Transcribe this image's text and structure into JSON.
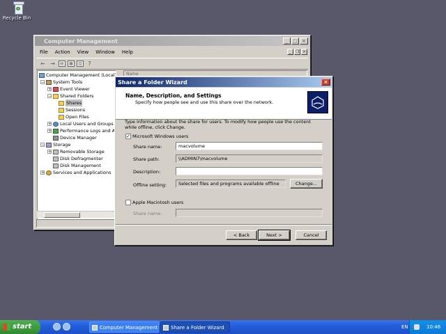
{
  "desktop": {
    "recycle_bin_label": "Recycle Bin"
  },
  "computer_management": {
    "title": "Computer Management",
    "menu": [
      "File",
      "Action",
      "View",
      "Window",
      "Help"
    ],
    "column_header": "Name",
    "tree": [
      {
        "label": "Computer Management (Local)",
        "icon": "computer-icon"
      },
      {
        "label": "System Tools",
        "icon": "tools-icon"
      },
      {
        "label": "Event Viewer",
        "icon": "event-viewer-icon"
      },
      {
        "label": "Shared Folders",
        "icon": "folder-icon"
      },
      {
        "label": "Shares",
        "icon": "folder-icon"
      },
      {
        "label": "Sessions",
        "icon": "folder-icon"
      },
      {
        "label": "Open Files",
        "icon": "folder-icon"
      },
      {
        "label": "Local Users and Groups",
        "icon": "users-icon"
      },
      {
        "label": "Performance Logs and Al",
        "icon": "performance-icon"
      },
      {
        "label": "Device Manager",
        "icon": "device-manager-icon"
      },
      {
        "label": "Storage",
        "icon": "storage-icon"
      },
      {
        "label": "Removable Storage",
        "icon": "disk-icon"
      },
      {
        "label": "Disk Defragmenter",
        "icon": "disk-icon"
      },
      {
        "label": "Disk Management",
        "icon": "disk-icon"
      },
      {
        "label": "Services and Applications",
        "icon": "services-icon"
      }
    ]
  },
  "wizard": {
    "title": "Share a Folder Wizard",
    "heading": "Name, Description, and Settings",
    "subheading": "Specify how people see and use this share over the network.",
    "intro": "Type information about the share for users. To modify how people use the content while offline, click Change.",
    "ms_users_label": "Microsoft Windows users",
    "ms_checked_glyph": "✓",
    "share_name_label": "Share name:",
    "share_name_value": "macvolume",
    "share_path_label": "Share path:",
    "share_path_value": "\\\\ADMIN7\\macvolume",
    "description_label": "Description:",
    "description_value": "",
    "offline_label": "Offline setting:",
    "offline_value": "Selected files and programs available offline",
    "change_button": "Change...",
    "mac_users_label": "Apple Macintosh users",
    "mac_share_name_label": "Share name:",
    "back_button": "< Back",
    "next_button": "Next >",
    "cancel_button": "Cancel"
  },
  "taskbar": {
    "start_label": "start",
    "tasks": [
      "Computer Management",
      "Share a Folder Wizard"
    ],
    "language": "EN",
    "clock": "10:46"
  }
}
